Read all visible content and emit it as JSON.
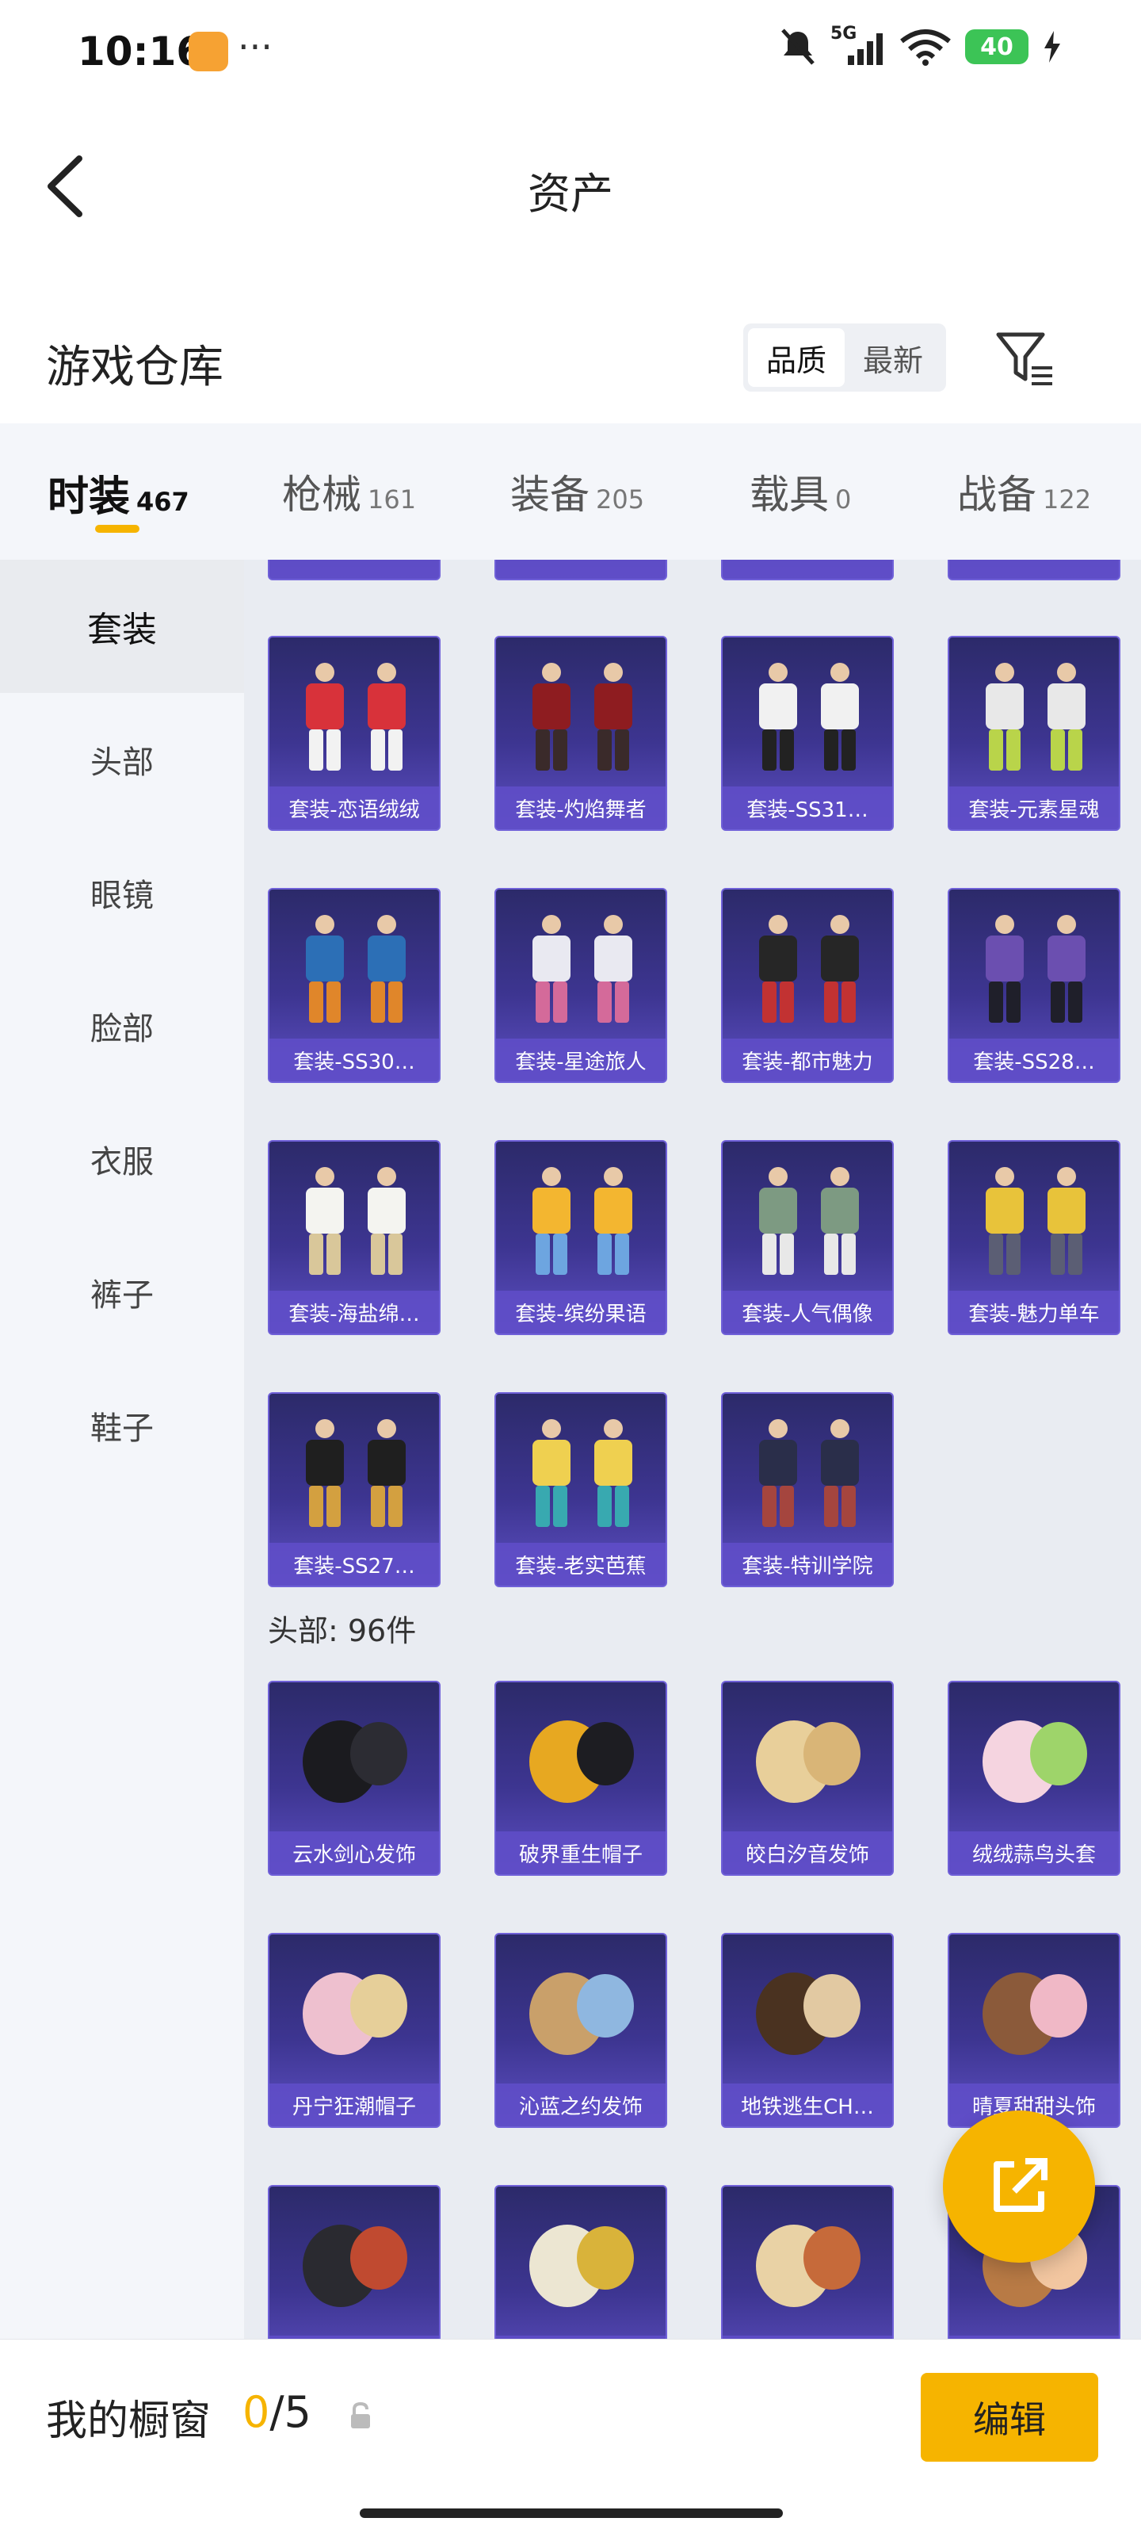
{
  "status_bar": {
    "time": "10:16",
    "dots": "···",
    "battery": "40",
    "signal_label": "5G"
  },
  "header": {
    "title": "资产"
  },
  "warehouse": {
    "title": "游戏仓库",
    "sort_quality": "品质",
    "sort_newest": "最新"
  },
  "tabs": [
    {
      "label": "时装",
      "count": "467"
    },
    {
      "label": "枪械",
      "count": "161"
    },
    {
      "label": "装备",
      "count": "205"
    },
    {
      "label": "载具",
      "count": "0"
    },
    {
      "label": "战备",
      "count": "122"
    }
  ],
  "sidebar": [
    "套装",
    "头部",
    "眼镜",
    "脸部",
    "衣服",
    "裤子",
    "鞋子"
  ],
  "suits": [
    {
      "name": "套装-恋语绒绒",
      "icon": "outfit-red-white"
    },
    {
      "name": "套装-灼焰舞者",
      "icon": "outfit-dark-red"
    },
    {
      "name": "套装-SS31…",
      "icon": "outfit-white-black"
    },
    {
      "name": "套装-元素星魂",
      "icon": "outfit-white-green"
    },
    {
      "name": "套装-SS30…",
      "icon": "outfit-blue-orange"
    },
    {
      "name": "套装-星途旅人",
      "icon": "outfit-white-pink"
    },
    {
      "name": "套装-都市魅力",
      "icon": "outfit-black-red"
    },
    {
      "name": "套装-SS28…",
      "icon": "outfit-purple-black"
    },
    {
      "name": "套装-海盐绵…",
      "icon": "outfit-white-dress"
    },
    {
      "name": "套装-缤纷果语",
      "icon": "outfit-yellow-floral"
    },
    {
      "name": "套装-人气偶像",
      "icon": "outfit-green-jacket"
    },
    {
      "name": "套装-魅力单车",
      "icon": "outfit-yellow-shorts"
    },
    {
      "name": "套装-SS27…",
      "icon": "outfit-black-gold"
    },
    {
      "name": "套装-老实芭蕉",
      "icon": "outfit-banana"
    },
    {
      "name": "套装-特训学院",
      "icon": "outfit-navy-skirt"
    }
  ],
  "head_section": {
    "label": "头部: 96件"
  },
  "heads": [
    {
      "name": "云水剑心发饰",
      "icon": "hair-black"
    },
    {
      "name": "破界重生帽子",
      "icon": "cap-yellow"
    },
    {
      "name": "皎白汐音发饰",
      "icon": "hair-blonde"
    },
    {
      "name": "绒绒蒜鸟头套",
      "icon": "plush-head"
    },
    {
      "name": "丹宁狂潮帽子",
      "icon": "hair-pink-blonde"
    },
    {
      "name": "沁蓝之约发饰",
      "icon": "hair-light-brown"
    },
    {
      "name": "地铁逃生CH…",
      "icon": "hat-brown"
    },
    {
      "name": "晴夏甜甜头饰",
      "icon": "hair-brown-bow"
    },
    {
      "name": "",
      "icon": "helmet-dark"
    },
    {
      "name": "",
      "icon": "dog-head"
    },
    {
      "name": "",
      "icon": "hair-braid"
    },
    {
      "name": "",
      "icon": "hair-twin-braid"
    }
  ],
  "showcase": {
    "label": "我的橱窗",
    "current": "0",
    "sep_total": "/5",
    "edit_label": "编辑"
  },
  "colors": {
    "accent": "#f6b400",
    "card_top": "#2c2a6a",
    "card_bottom": "#5d4fc2"
  }
}
